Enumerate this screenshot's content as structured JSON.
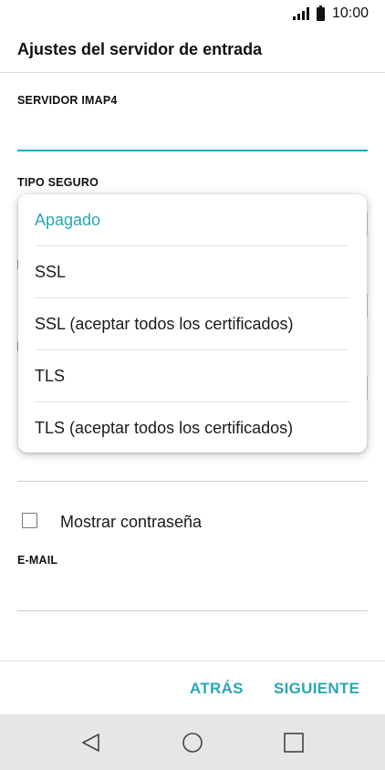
{
  "status_bar": {
    "time": "10:00",
    "icons": [
      "signal-icon",
      "battery-icon"
    ]
  },
  "header": {
    "title": "Ajustes del servidor de entrada"
  },
  "form": {
    "imap_label": "SERVIDOR IMAP4",
    "security_label": "TIPO SEGURO",
    "show_password_label": "Mostrar contraseña",
    "email_label": "E-MAIL"
  },
  "dropdown": {
    "options": [
      {
        "label": "Apagado",
        "selected": true
      },
      {
        "label": "SSL",
        "selected": false
      },
      {
        "label": "SSL (aceptar todos los certificados)",
        "selected": false
      },
      {
        "label": "TLS",
        "selected": false
      },
      {
        "label": "TLS (aceptar todos los certificados)",
        "selected": false
      }
    ]
  },
  "actions": {
    "back_label": "ATRÁS",
    "next_label": "SIGUIENTE"
  },
  "nav_bar": {
    "icons": [
      "back-triangle-icon",
      "home-circle-icon",
      "recents-square-icon"
    ]
  },
  "colors": {
    "accent": "#2aa6b8",
    "nav_background": "#e6e6e8"
  }
}
